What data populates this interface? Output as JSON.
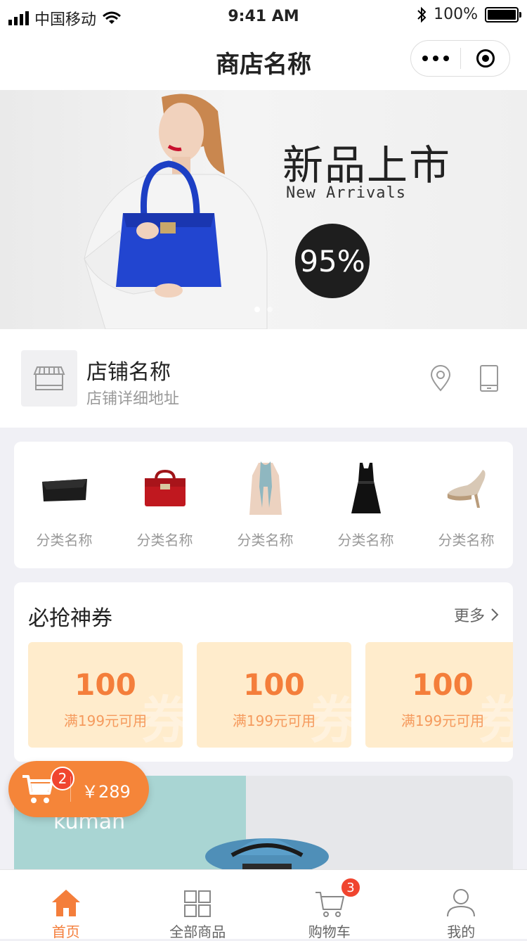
{
  "status_bar": {
    "carrier": "中国移动",
    "time": "9:41 AM",
    "battery": "100%",
    "battery_level": 1.0
  },
  "nav": {
    "title": "商店名称"
  },
  "banner": {
    "title": "新品上市",
    "subtitle": "New Arrivals",
    "badge": "95%",
    "slide_count": 2,
    "active_slide": 0
  },
  "store": {
    "name": "店铺名称",
    "address": "店铺详细地址"
  },
  "categories": [
    {
      "label": "分类名称",
      "icon": "clutch-bag-icon"
    },
    {
      "label": "分类名称",
      "icon": "handbag-icon"
    },
    {
      "label": "分类名称",
      "icon": "coat-icon"
    },
    {
      "label": "分类名称",
      "icon": "dress-icon"
    },
    {
      "label": "分类名称",
      "icon": "high-heel-icon"
    }
  ],
  "coupons": {
    "title": "必抢神券",
    "more": "更多",
    "items": [
      {
        "amount": "100",
        "condition": "满199元可用"
      },
      {
        "amount": "100",
        "condition": "满199元可用"
      },
      {
        "amount": "100",
        "condition": "满199元可用"
      }
    ]
  },
  "promo": {
    "text": "kuman"
  },
  "floating_cart": {
    "count": "2",
    "price": "￥289"
  },
  "tabs": [
    {
      "label": "首页",
      "active": true
    },
    {
      "label": "全部商品",
      "active": false
    },
    {
      "label": "购物车",
      "active": false,
      "badge": "3"
    },
    {
      "label": "我的",
      "active": false
    }
  ],
  "colors": {
    "accent": "#f47e3b",
    "badge": "#f0452f",
    "coupon_bg": "#ffeccc"
  }
}
